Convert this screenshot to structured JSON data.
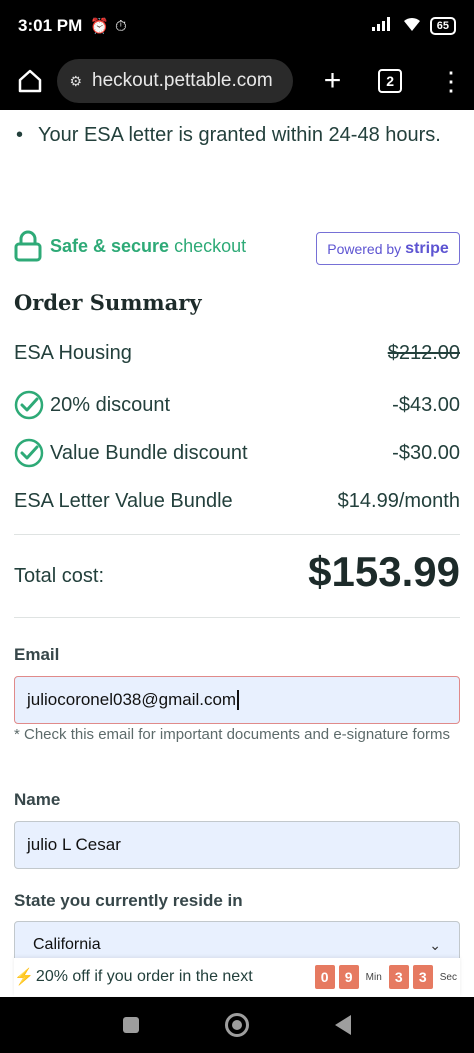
{
  "status_bar": {
    "time": "3:01 PM",
    "icons": [
      "alarm-clock-icon",
      "alarm-icon",
      "signal-icon",
      "wifi-icon"
    ],
    "battery": "65"
  },
  "browser": {
    "url": "heckout.pettable.com",
    "tab_count": "2",
    "plus_label": "+",
    "menu_label": "⋮"
  },
  "content": {
    "bullet_text": "Your ESA letter is granted within 24-48 hours.",
    "secure_bold": "Safe & secure",
    "secure_rest": "checkout",
    "powered_by": "Powered by",
    "stripe": "stripe",
    "summary_title": "Order Summary",
    "items": [
      {
        "label": "ESA Housing",
        "amount": "$212.00"
      },
      {
        "label": "20% discount",
        "amount": "-$43.00"
      },
      {
        "label": "Value Bundle discount",
        "amount": "-$30.00"
      },
      {
        "label": "ESA Letter Value Bundle",
        "amount": "$14.99/month"
      }
    ],
    "total_label": "Total cost:",
    "total_value": "$153.99"
  },
  "form": {
    "email_label": "Email",
    "email_value": "juliocoronel038@gmail.com",
    "email_hint": "* Check this email for important documents and e-signature forms",
    "name_label": "Name",
    "name_value": "julio L Cesar",
    "state_label": "State you currently reside in",
    "state_value": "California"
  },
  "promo": {
    "bolt": "⚡",
    "text": "20% off if you order in the next",
    "min_digits": [
      "0",
      "9"
    ],
    "min_label": "Min",
    "sec_digits": [
      "3",
      "3"
    ],
    "sec_label": "Sec"
  },
  "colors": {
    "accent_green": "#2eaa77",
    "stripe_purple": "#5d54d2",
    "timer_orange": "#e67a61",
    "field_bg": "#e8f0fe"
  }
}
